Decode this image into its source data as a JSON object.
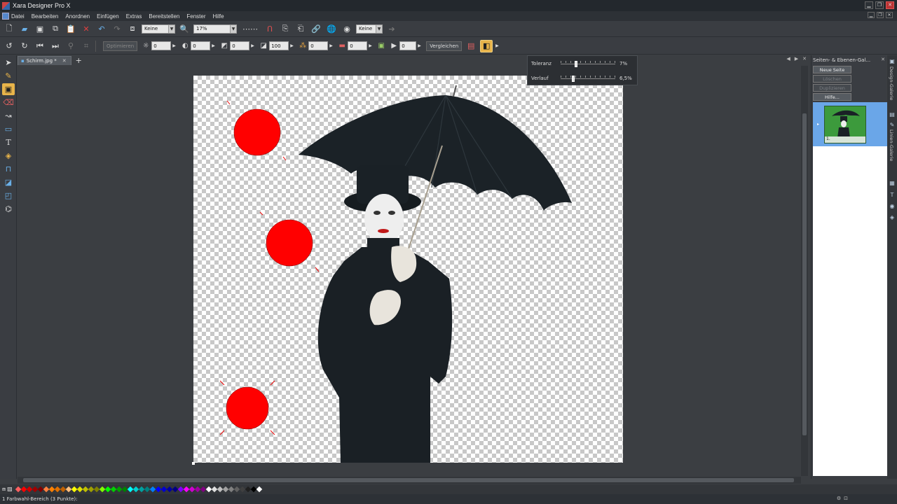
{
  "app": {
    "title": "Xara Designer Pro X"
  },
  "menu": [
    "Datei",
    "Bearbeiten",
    "Anordnen",
    "Einfügen",
    "Extras",
    "Bereitstellen",
    "Fenster",
    "Hilfe"
  ],
  "toolbar1": {
    "combo_keine_1": "Keine",
    "zoom": "17%",
    "combo_keine_2": "Keine"
  },
  "toolbar2": {
    "optimieren": "Optimieren",
    "spin_values": [
      "0",
      "0",
      "0",
      "100",
      "0",
      "0",
      "0"
    ],
    "vergleichen": "Vergleichen"
  },
  "tab": {
    "name": "Schirm.jpg *"
  },
  "popup": {
    "toleranz_label": "Toleranz",
    "toleranz_value": "7%",
    "toleranz_level": 0.25,
    "verlauf_label": "Verlauf",
    "verlauf_value": "6,5%",
    "verlauf_level": 0.2
  },
  "gallery": {
    "title": "Seiten- & Ebenen-Gal...",
    "buttons": [
      "Neue Seite",
      "Löschen",
      "Duplizieren",
      "Hilfe..."
    ],
    "page_number": "1."
  },
  "vtabs": [
    "Design-Galerie",
    "Linien-Galerie"
  ],
  "palette_colors": [
    "#ff6060",
    "#ff0000",
    "#d00000",
    "#a00000",
    "#800000",
    "#ff8040",
    "#ff8000",
    "#e07000",
    "#c06000",
    "#ffc080",
    "#ffff00",
    "#e0e000",
    "#c0c000",
    "#a0a000",
    "#808000",
    "#80ff00",
    "#00ff00",
    "#00d000",
    "#00a000",
    "#008000",
    "#00ffff",
    "#00d0d0",
    "#00a0a0",
    "#008080",
    "#0080ff",
    "#0000ff",
    "#0000d0",
    "#0000a0",
    "#000080",
    "#8000ff",
    "#ff00ff",
    "#d000d0",
    "#a000a0",
    "#800080",
    "#ffffff",
    "#e0e0e0",
    "#c0c0c0",
    "#a0a0a0",
    "#808080",
    "#606060",
    "#404040",
    "#202020",
    "#000000",
    "#ffffff"
  ],
  "status": {
    "text": "1 Farbwahl-Bereich (3 Punkte):"
  }
}
